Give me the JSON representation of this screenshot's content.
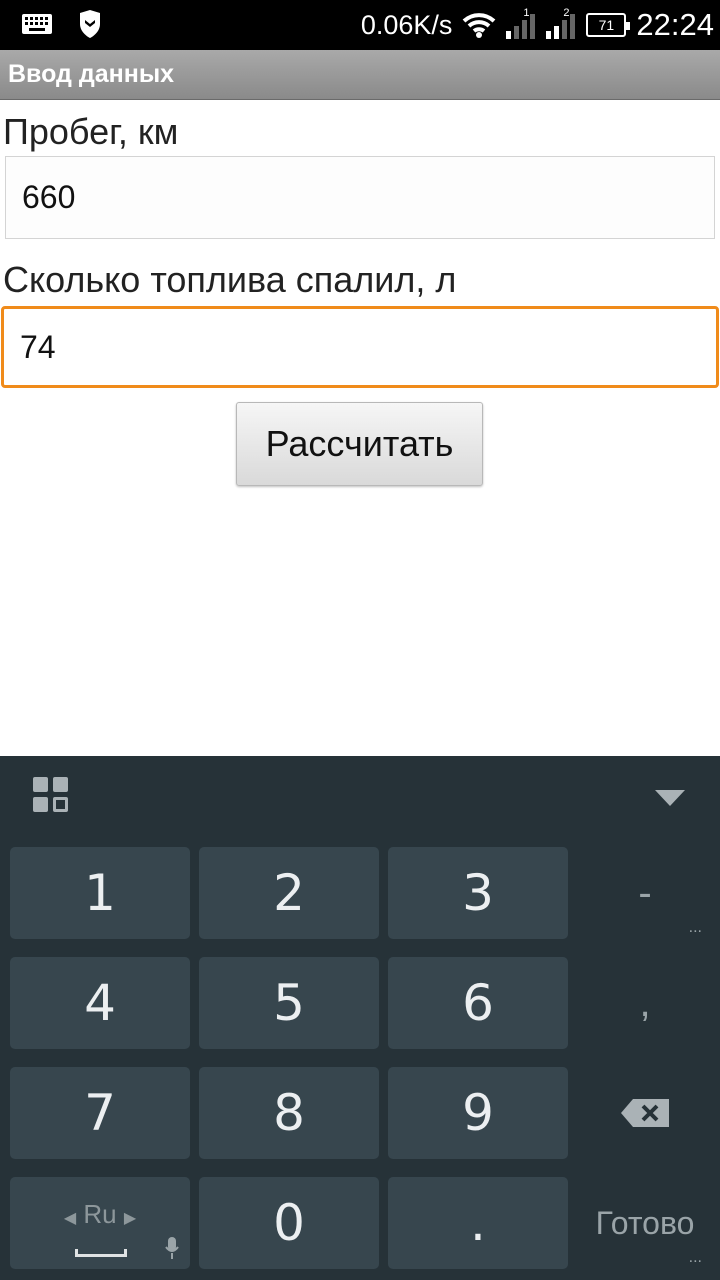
{
  "status_bar": {
    "net_speed": "0.06K/s",
    "sim1_label": "1",
    "sim2_label": "2",
    "battery_level": "71",
    "time": "22:24"
  },
  "app": {
    "title": "Ввод данных"
  },
  "form": {
    "mileage_label": "Пробег, км",
    "mileage_value": "660",
    "fuel_label": "Сколько топлива спалил, л",
    "fuel_value": "74",
    "calculate_label": "Рассчитать"
  },
  "keyboard": {
    "keys": [
      "1",
      "2",
      "3",
      "4",
      "5",
      "6",
      "7",
      "8",
      "9",
      "0",
      "."
    ],
    "minus": "-",
    "comma": ",",
    "language": "Ru",
    "done_label": "Готово",
    "more_dots": "..."
  }
}
